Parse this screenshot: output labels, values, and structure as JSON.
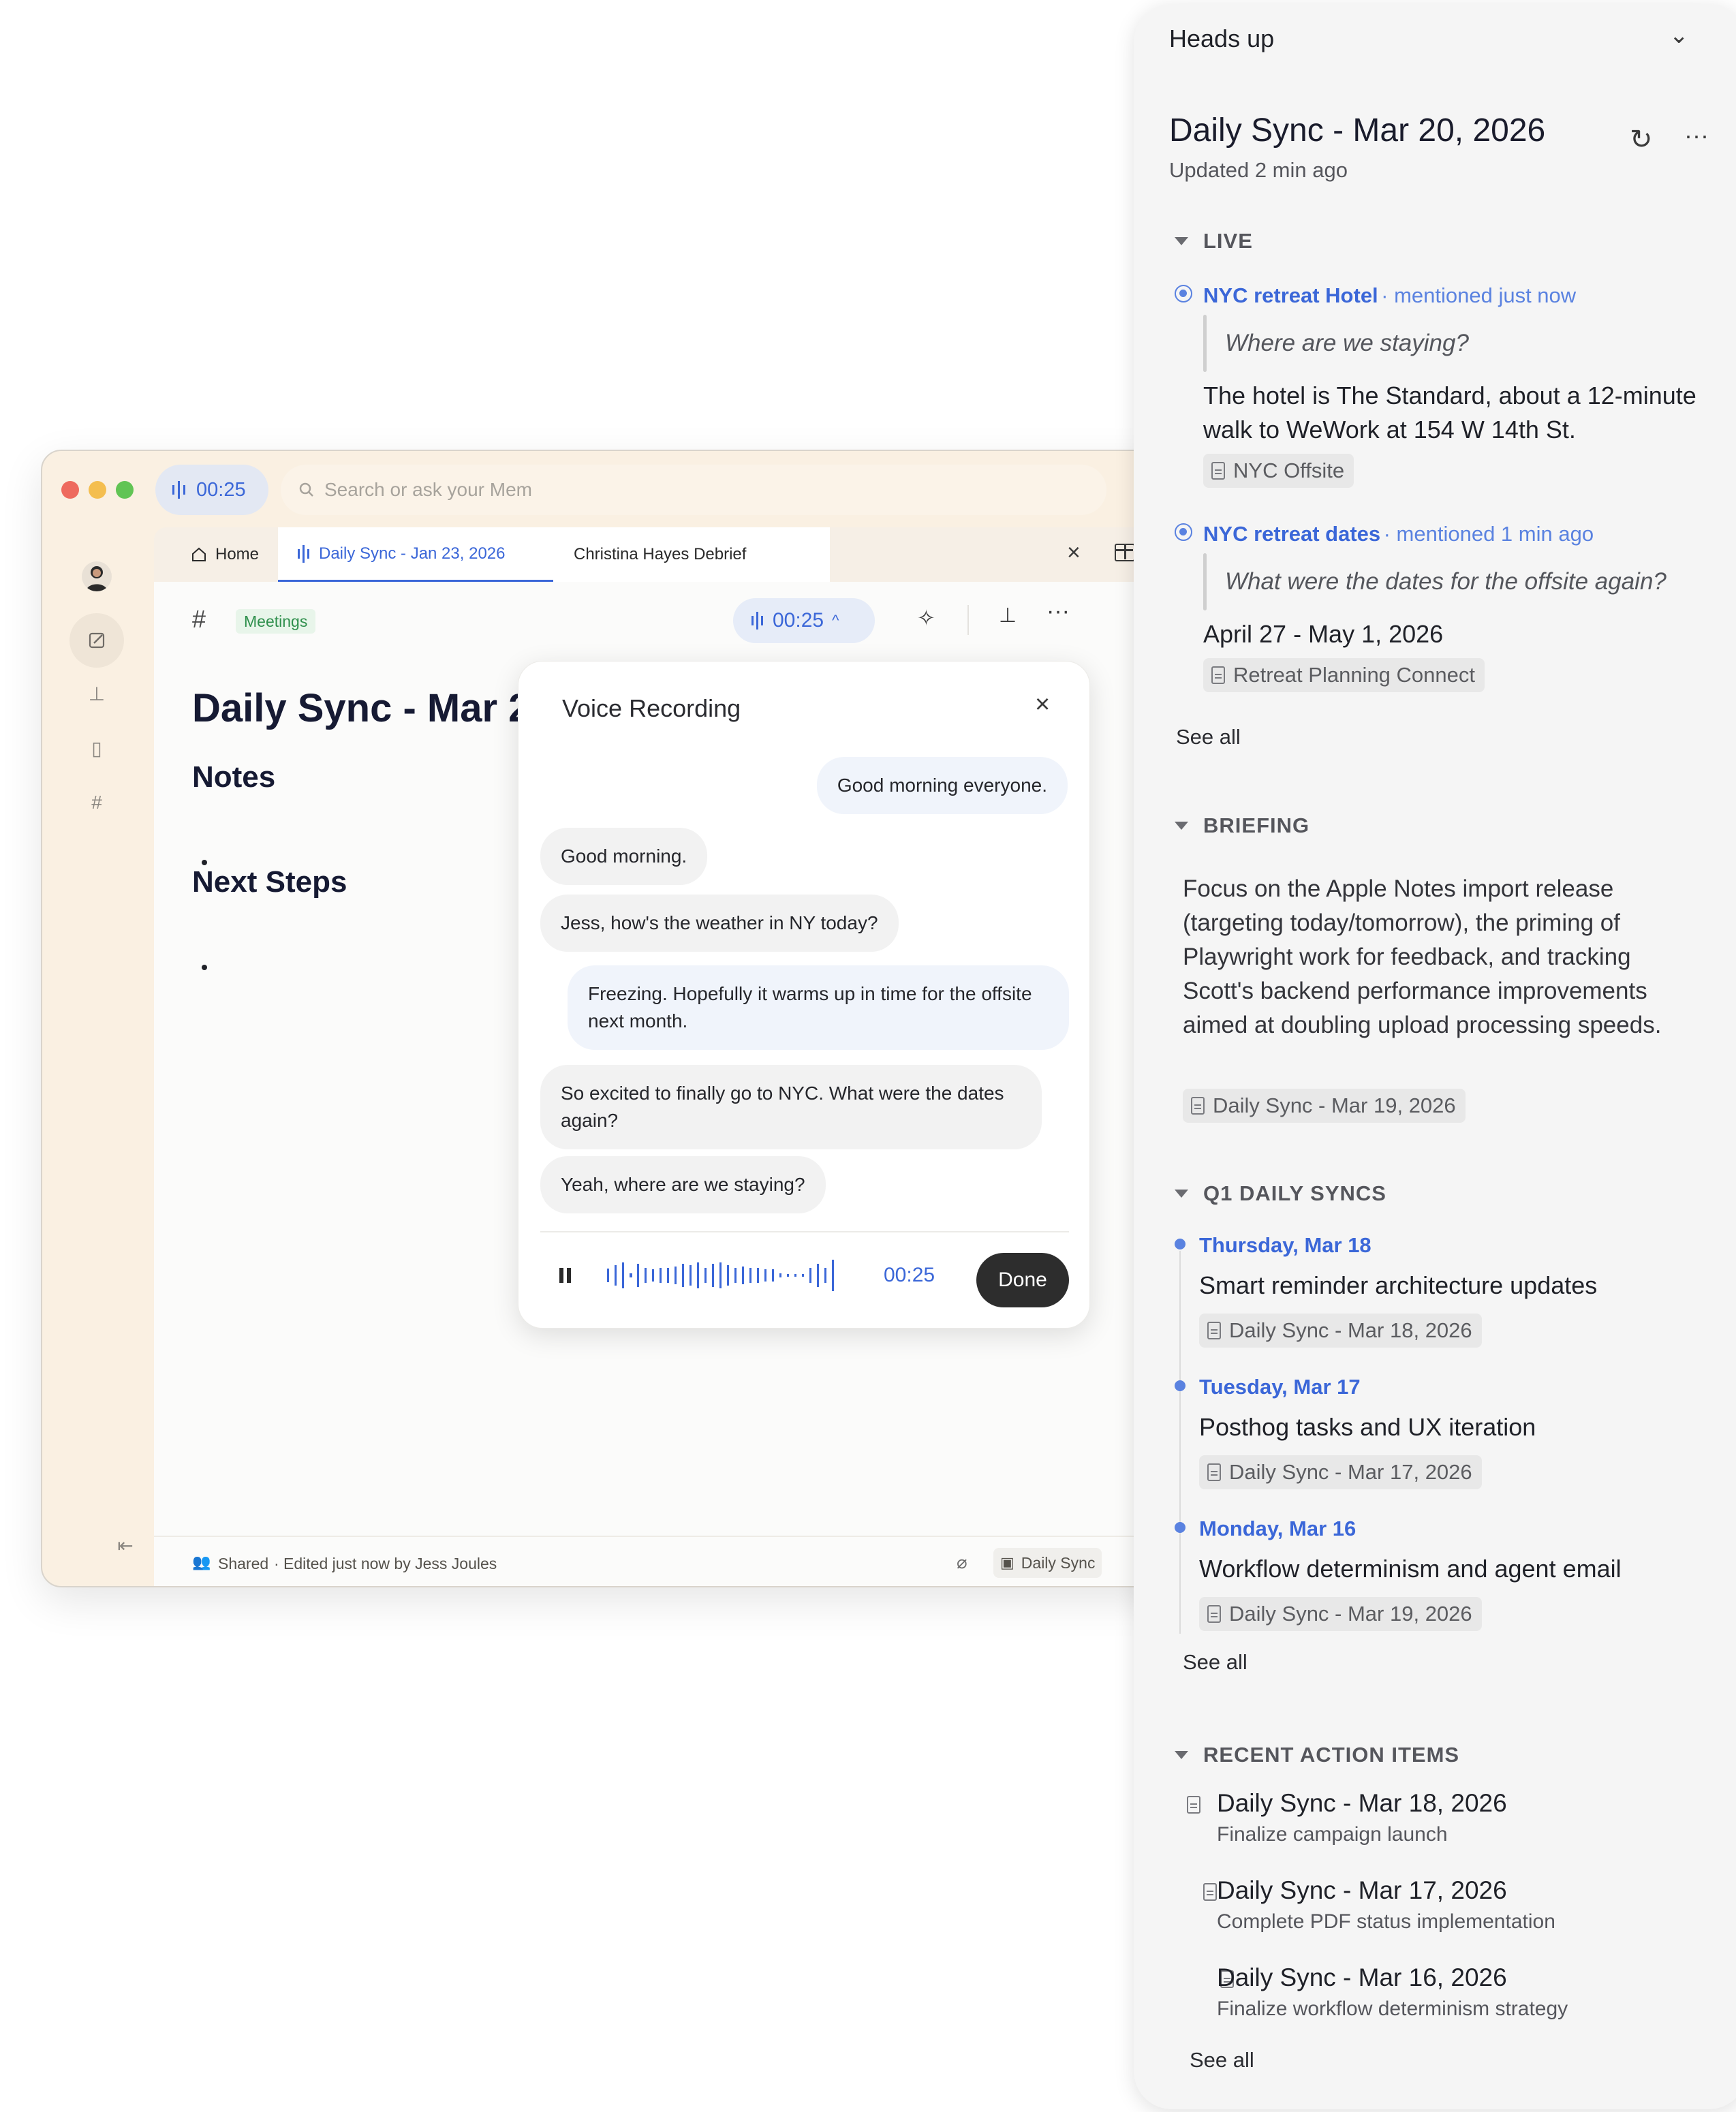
{
  "app": {
    "recording_timer": "00:25",
    "search_placeholder": "Search or ask your Mem",
    "tabs": [
      {
        "label": "Home"
      },
      {
        "label": "Daily Sync - Jan 23, 2026"
      },
      {
        "label": "Christina Hayes Debrief"
      }
    ],
    "tag": "Meetings",
    "toolbar_timer": "00:25",
    "doc_title": "Daily Sync - Mar 20, 2026",
    "sections": [
      {
        "heading": "Notes"
      },
      {
        "heading": "Next Steps"
      }
    ],
    "footer": {
      "shared": "Shared",
      "edited": "· Edited just now by Jess Joules",
      "collection": "Daily Sync"
    }
  },
  "voice_popup": {
    "title": "Voice Recording",
    "messages": [
      {
        "speaker": "me",
        "text": "Good morning everyone."
      },
      {
        "speaker": "them",
        "text": "Good morning."
      },
      {
        "speaker": "them",
        "text": "Jess, how's the weather in NY today?"
      },
      {
        "speaker": "me",
        "text": "Freezing. Hopefully it warms up in time for the offsite next month."
      },
      {
        "speaker": "them",
        "text": "So excited to finally go to NYC. What were the dates again?"
      },
      {
        "speaker": "them",
        "text": "Yeah, where are we staying?"
      }
    ],
    "timer": "00:25",
    "done_label": "Done"
  },
  "heads_up": {
    "panel_title": "Heads up",
    "meeting_title": "Daily Sync - Mar 20, 2026",
    "updated": "Updated 2 min ago",
    "live": {
      "heading": "LIVE",
      "items": [
        {
          "title": "NYC retreat Hotel",
          "meta": "· mentioned just now",
          "question": "Where are we staying?",
          "answer": "The hotel is The Standard, about a 12-minute walk to WeWork at 154 W 14th St.",
          "source": "NYC Offsite"
        },
        {
          "title": "NYC retreat dates",
          "meta": "· mentioned 1 min ago",
          "question": "What were the dates for the offsite again?",
          "answer": "April 27 - May 1, 2026",
          "source": "Retreat Planning Connect"
        }
      ],
      "see_all": "See all"
    },
    "briefing": {
      "heading": "BRIEFING",
      "text": "Focus on the Apple Notes import release (targeting today/tomorrow), the priming of Playwright work for feedback, and tracking Scott's backend performance improvements aimed at doubling upload processing speeds.",
      "source": "Daily Sync - Mar 19, 2026"
    },
    "q1_syncs": {
      "heading": "Q1 DAILY SYNCS",
      "items": [
        {
          "day": "Thursday, Mar 18",
          "title": "Smart reminder architecture updates",
          "source": "Daily Sync - Mar 18, 2026"
        },
        {
          "day": "Tuesday, Mar 17",
          "title": "Posthog tasks and UX iteration",
          "source": "Daily Sync - Mar 17, 2026"
        },
        {
          "day": "Monday, Mar 16",
          "title": "Workflow determinism and agent email",
          "source": "Daily Sync - Mar 19, 2026"
        }
      ],
      "see_all": "See all"
    },
    "action_items": {
      "heading": "RECENT ACTION ITEMS",
      "items": [
        {
          "title": "Daily Sync - Mar 18, 2026",
          "subtitle": "Finalize campaign launch"
        },
        {
          "title": "Daily Sync - Mar 17, 2026",
          "subtitle": "Complete PDF status implementation"
        },
        {
          "title": "Daily Sync - Mar 16, 2026",
          "subtitle": "Finalize workflow determinism strategy"
        }
      ],
      "see_all": "See all"
    }
  },
  "colors": {
    "accent": "#3b67d8",
    "window_bg": "#faf0e2",
    "panel_bg": "#f5f5f5",
    "traffic_red": "#ee6a5e",
    "traffic_yellow": "#f4be4f",
    "traffic_green": "#61c454"
  }
}
